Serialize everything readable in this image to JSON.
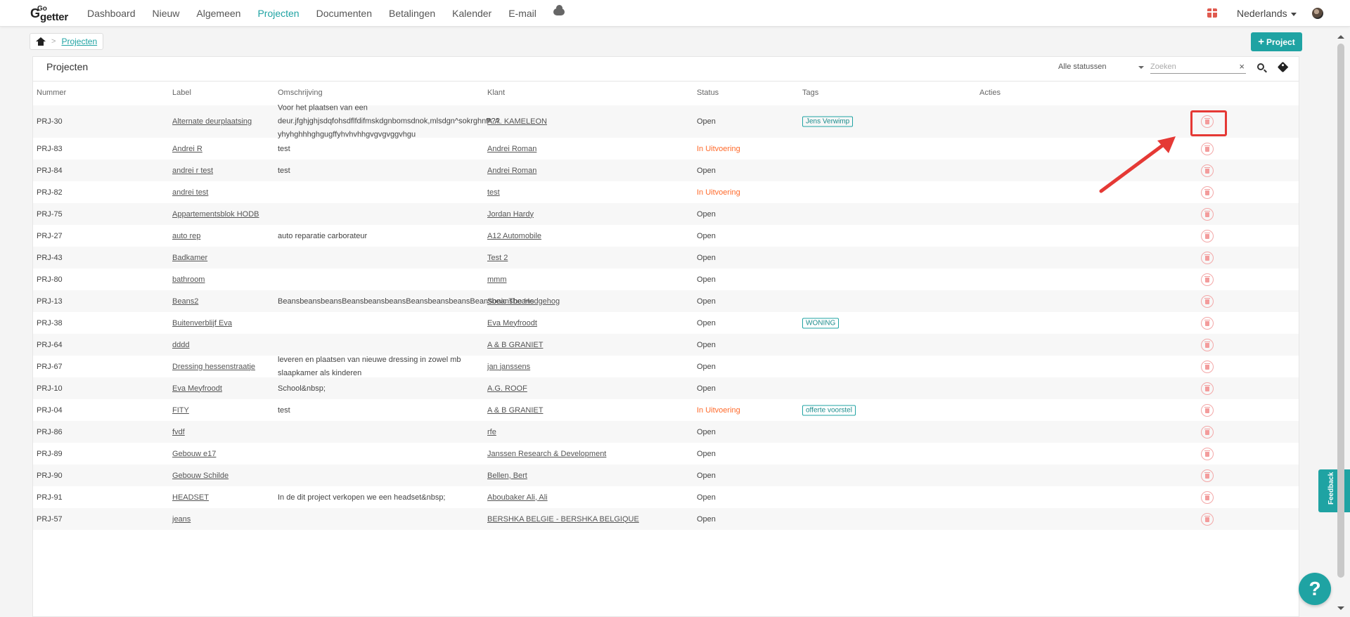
{
  "logo": {
    "letter": "G",
    "go": "Go",
    "getter": "getter"
  },
  "nav": [
    {
      "label": "Dashboard",
      "active": false
    },
    {
      "label": "Nieuw",
      "active": false
    },
    {
      "label": "Algemeen",
      "active": false
    },
    {
      "label": "Projecten",
      "active": true
    },
    {
      "label": "Documenten",
      "active": false
    },
    {
      "label": "Betalingen",
      "active": false
    },
    {
      "label": "Kalender",
      "active": false
    },
    {
      "label": "E-mail",
      "active": false
    }
  ],
  "header": {
    "language": "Nederlands",
    "gift_icon": "gift-icon",
    "cloud_icon": "cloud-icon"
  },
  "breadcrumb": {
    "current": "Projecten"
  },
  "add_button": {
    "label": "Project"
  },
  "panel": {
    "title": "Projecten",
    "status_filter": "Alle statussen",
    "search_placeholder": "Zoeken"
  },
  "columns": [
    "Nummer",
    "Label",
    "Omschrijving",
    "Klant",
    "Status",
    "Tags",
    "Acties"
  ],
  "rows": [
    {
      "nummer": "PRJ-30",
      "label": "Alternate deurplaatsing",
      "omschrijving": "Voor het plaatsen van een deur.jfghjghjsdqfohsdflfdifmskdgnbomsdnok,mlsdgn^sokrghn₱?? yhyhghhhghgugffyhvhvhhgvgvgvggvhgu",
      "klant": "A.A. KAMELEON",
      "status": "Open",
      "tag": "Jens Verwimp"
    },
    {
      "nummer": "PRJ-83",
      "label": "Andrei R",
      "omschrijving": "test",
      "klant": "Andrei Roman",
      "status": "In Uitvoering",
      "tag": ""
    },
    {
      "nummer": "PRJ-84",
      "label": "andrei r test",
      "omschrijving": "test",
      "klant": "Andrei Roman",
      "status": "Open",
      "tag": ""
    },
    {
      "nummer": "PRJ-82",
      "label": "andrei test",
      "omschrijving": "",
      "klant": "test",
      "status": "In Uitvoering",
      "tag": ""
    },
    {
      "nummer": "PRJ-75",
      "label": "Appartementsblok HODB",
      "omschrijving": "",
      "klant": "Jordan Hardy",
      "status": "Open",
      "tag": ""
    },
    {
      "nummer": "PRJ-27",
      "label": "auto rep",
      "omschrijving": "auto reparatie carborateur",
      "klant": "A12 Automobile",
      "status": "Open",
      "tag": ""
    },
    {
      "nummer": "PRJ-43",
      "label": "Badkamer",
      "omschrijving": "",
      "klant": "Test 2",
      "status": "Open",
      "tag": ""
    },
    {
      "nummer": "PRJ-80",
      "label": "bathroom",
      "omschrijving": "",
      "klant": "mmm",
      "status": "Open",
      "tag": ""
    },
    {
      "nummer": "PRJ-13",
      "label": "Beans2",
      "omschrijving": "BeansbeansbeansBeansbeansbeansBeansbeansbeansBeansbeansbeans",
      "klant": "Sonic The Hedgehog",
      "status": "Open",
      "tag": ""
    },
    {
      "nummer": "PRJ-38",
      "label": "Buitenverblijf Eva",
      "omschrijving": "",
      "klant": "Eva Meyfroodt",
      "status": "Open",
      "tag": "WONING"
    },
    {
      "nummer": "PRJ-64",
      "label": "dddd",
      "omschrijving": "",
      "klant": "A & B GRANIET",
      "status": "Open",
      "tag": ""
    },
    {
      "nummer": "PRJ-67",
      "label": "Dressing hessenstraatje",
      "omschrijving": "leveren en plaatsen van nieuwe dressing in zowel mb slaapkamer als kinderen",
      "klant": "jan janssens",
      "status": "Open",
      "tag": ""
    },
    {
      "nummer": "PRJ-10",
      "label": "Eva Meyfroodt",
      "omschrijving": "School&nbsp;",
      "klant": "A.G. ROOF",
      "status": "Open",
      "tag": ""
    },
    {
      "nummer": "PRJ-04",
      "label": "FITY",
      "omschrijving": "test",
      "klant": "A & B GRANIET",
      "status": "In Uitvoering",
      "tag": "offerte voorstel"
    },
    {
      "nummer": "PRJ-86",
      "label": "fvdf",
      "omschrijving": "",
      "klant": "rfe",
      "status": "Open",
      "tag": ""
    },
    {
      "nummer": "PRJ-89",
      "label": "Gebouw e17",
      "omschrijving": "",
      "klant": "Janssen Research & Development",
      "status": "Open",
      "tag": ""
    },
    {
      "nummer": "PRJ-90",
      "label": "Gebouw Schilde",
      "omschrijving": "",
      "klant": "Bellen, Bert",
      "status": "Open",
      "tag": ""
    },
    {
      "nummer": "PRJ-91",
      "label": "HEADSET",
      "omschrijving": "In de dit project verkopen we een headset&nbsp;",
      "klant": "Aboubaker Ali, Ali",
      "status": "Open",
      "tag": ""
    },
    {
      "nummer": "PRJ-57",
      "label": "jeans",
      "omschrijving": "",
      "klant": "BERSHKA BELGIE - BERSHKA BELGIQUE",
      "status": "Open",
      "tag": ""
    }
  ],
  "status_colors": {
    "Open": "#333333",
    "In Uitvoering": "#ff6a2b"
  },
  "accent": "#1fa3a3",
  "feedback_label": "Feedback",
  "help_label": "?"
}
